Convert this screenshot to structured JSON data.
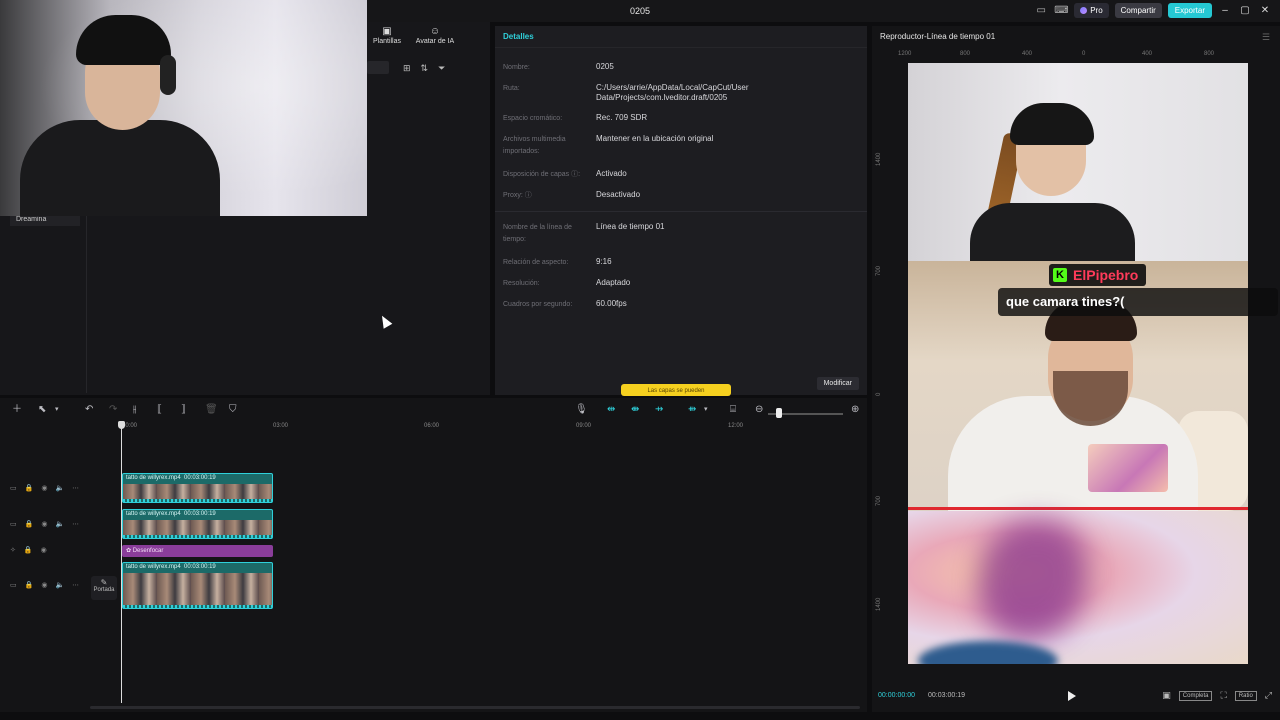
{
  "window": {
    "title": "0205",
    "pro_label": "Pro",
    "share_label": "Compartir",
    "export_label": "Exportar"
  },
  "left_panel": {
    "tabs": [
      {
        "label": "Plantillas",
        "icon": "template-icon"
      },
      {
        "label": "Avatar de IA",
        "icon": "avatar-icon"
      }
    ],
    "sidebar_item": "Dreamina"
  },
  "details": {
    "header": "Detalles",
    "rows": [
      {
        "label": "Nombre:",
        "value": "0205"
      },
      {
        "label": "Ruta:",
        "value": "C:/Users/arrie/AppData/Local/CapCut/User Data/Projects/com.lveditor.draft/0205"
      },
      {
        "label": "Espacio cromático:",
        "value": "Rec. 709 SDR"
      },
      {
        "label": "Archivos multimedia importados:",
        "value": "Mantener en la ubicación original"
      },
      {
        "label": "Disposición de capas ⓘ:",
        "value": "Activado"
      },
      {
        "label": "Proxy: ⓘ",
        "value": "Desactivado"
      },
      {
        "label": "Nombre de la línea de tiempo:",
        "value": "Línea de tiempo 01"
      },
      {
        "label": "Relación de aspecto:",
        "value": "9:16"
      },
      {
        "label": "Resolución:",
        "value": "Adaptado"
      },
      {
        "label": "Cuadros por segundo:",
        "value": "60.00fps"
      }
    ],
    "modify_label": "Modificar",
    "toast_text": "Las capas se pueden"
  },
  "player": {
    "header": "Reproductor-Línea de tiempo 01",
    "ruler_top": [
      "1200",
      "800",
      "400",
      "0",
      "400",
      "800"
    ],
    "ruler_left": [
      "1400",
      "700",
      "0",
      "700",
      "1400"
    ],
    "chat_user": "ElPipebro",
    "chat_message": "que camara tines?(",
    "timecode_current": "00:00:00:00",
    "timecode_total": "00:03:00:19",
    "complete_label": "Completa",
    "ratio_label": "Ratio"
  },
  "timeline": {
    "ruler": [
      "00:00",
      "03:00",
      "06:00",
      "09:00",
      "12:00"
    ],
    "clips": [
      {
        "name": "tatto de willyrex.mp4",
        "duration": "00:03:00:19"
      },
      {
        "name": "tatto de willyrex.mp4",
        "duration": "00:03:00:19"
      },
      {
        "name": "tatto de willyrex.mp4",
        "duration": "00:03:00:19"
      }
    ],
    "effect_label": "Desenfocar",
    "cover_label": "Portada"
  }
}
